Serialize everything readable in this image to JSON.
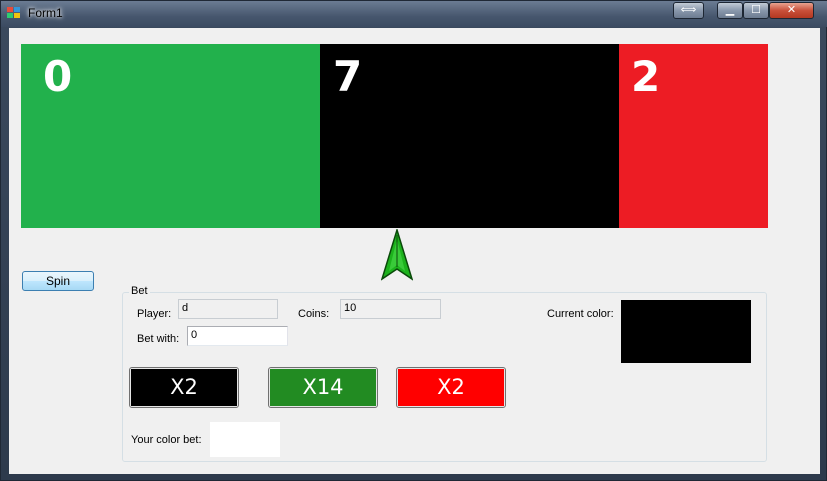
{
  "window": {
    "title": "Form1",
    "buttons": {
      "restore": "⟺",
      "minimize": "▁",
      "maximize": "☐",
      "close": "✕"
    }
  },
  "wheel": {
    "segments": [
      {
        "number": "0",
        "color": "#22b14c"
      },
      {
        "number": "7",
        "color": "#000000"
      },
      {
        "number": "2",
        "color": "#ed1c24"
      }
    ],
    "pointer_color": "#1db21d"
  },
  "spin_label": "Spin",
  "bet": {
    "legend": "Bet",
    "player_label": "Player:",
    "player_value": "d",
    "coins_label": "Coins:",
    "coins_value": "10",
    "bet_with_label": "Bet with:",
    "bet_with_value": "0",
    "current_color_label": "Current color:",
    "current_color": "#000000",
    "buttons": [
      {
        "label": "X2",
        "color": "#000000"
      },
      {
        "label": "X14",
        "color": "#228b22"
      },
      {
        "label": "X2",
        "color": "#ff0000"
      }
    ],
    "your_color_bet_label": "Your color bet:"
  }
}
